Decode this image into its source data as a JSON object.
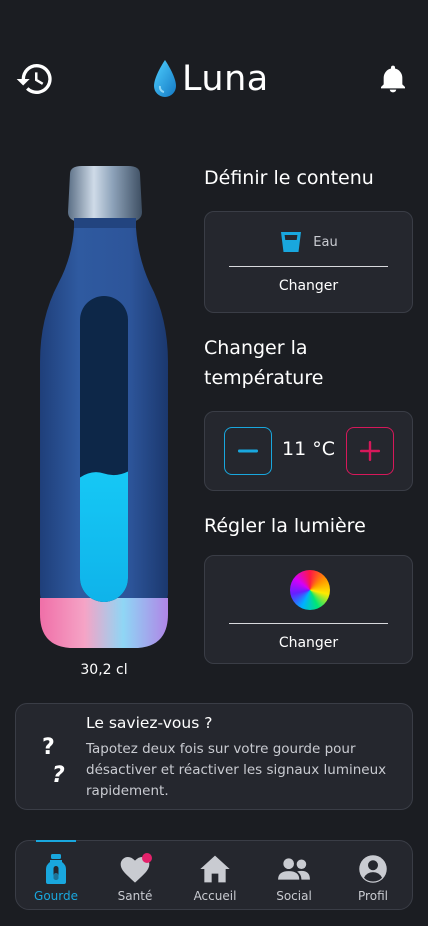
{
  "header": {
    "logo_text": "Luna"
  },
  "bottle": {
    "fill_level": 0.42,
    "volume": "30,2 cl"
  },
  "content": {
    "title": "Définir le contenu",
    "drink_label": "Eau",
    "change_label": "Changer"
  },
  "temperature": {
    "title": "Changer la température",
    "value": "11 °C"
  },
  "light": {
    "title": "Régler la lumière",
    "change_label": "Changer"
  },
  "tip": {
    "title": "Le saviez-vous ?",
    "body": "Tapotez deux fois sur votre gourde pour désactiver et réactiver les signaux lumineux rapidement."
  },
  "nav": {
    "items": [
      {
        "label": "Gourde",
        "icon": "bottle-icon",
        "active": true
      },
      {
        "label": "Santé",
        "icon": "heart-icon",
        "active": false
      },
      {
        "label": "Accueil",
        "icon": "home-icon",
        "active": false
      },
      {
        "label": "Social",
        "icon": "people-icon",
        "active": false
      },
      {
        "label": "Profil",
        "icon": "profile-icon",
        "active": false
      }
    ]
  },
  "colors": {
    "background": "#1b1d22",
    "card": "#25272e",
    "accent_blue": "#19a7de",
    "accent_pink": "#d6185a"
  }
}
